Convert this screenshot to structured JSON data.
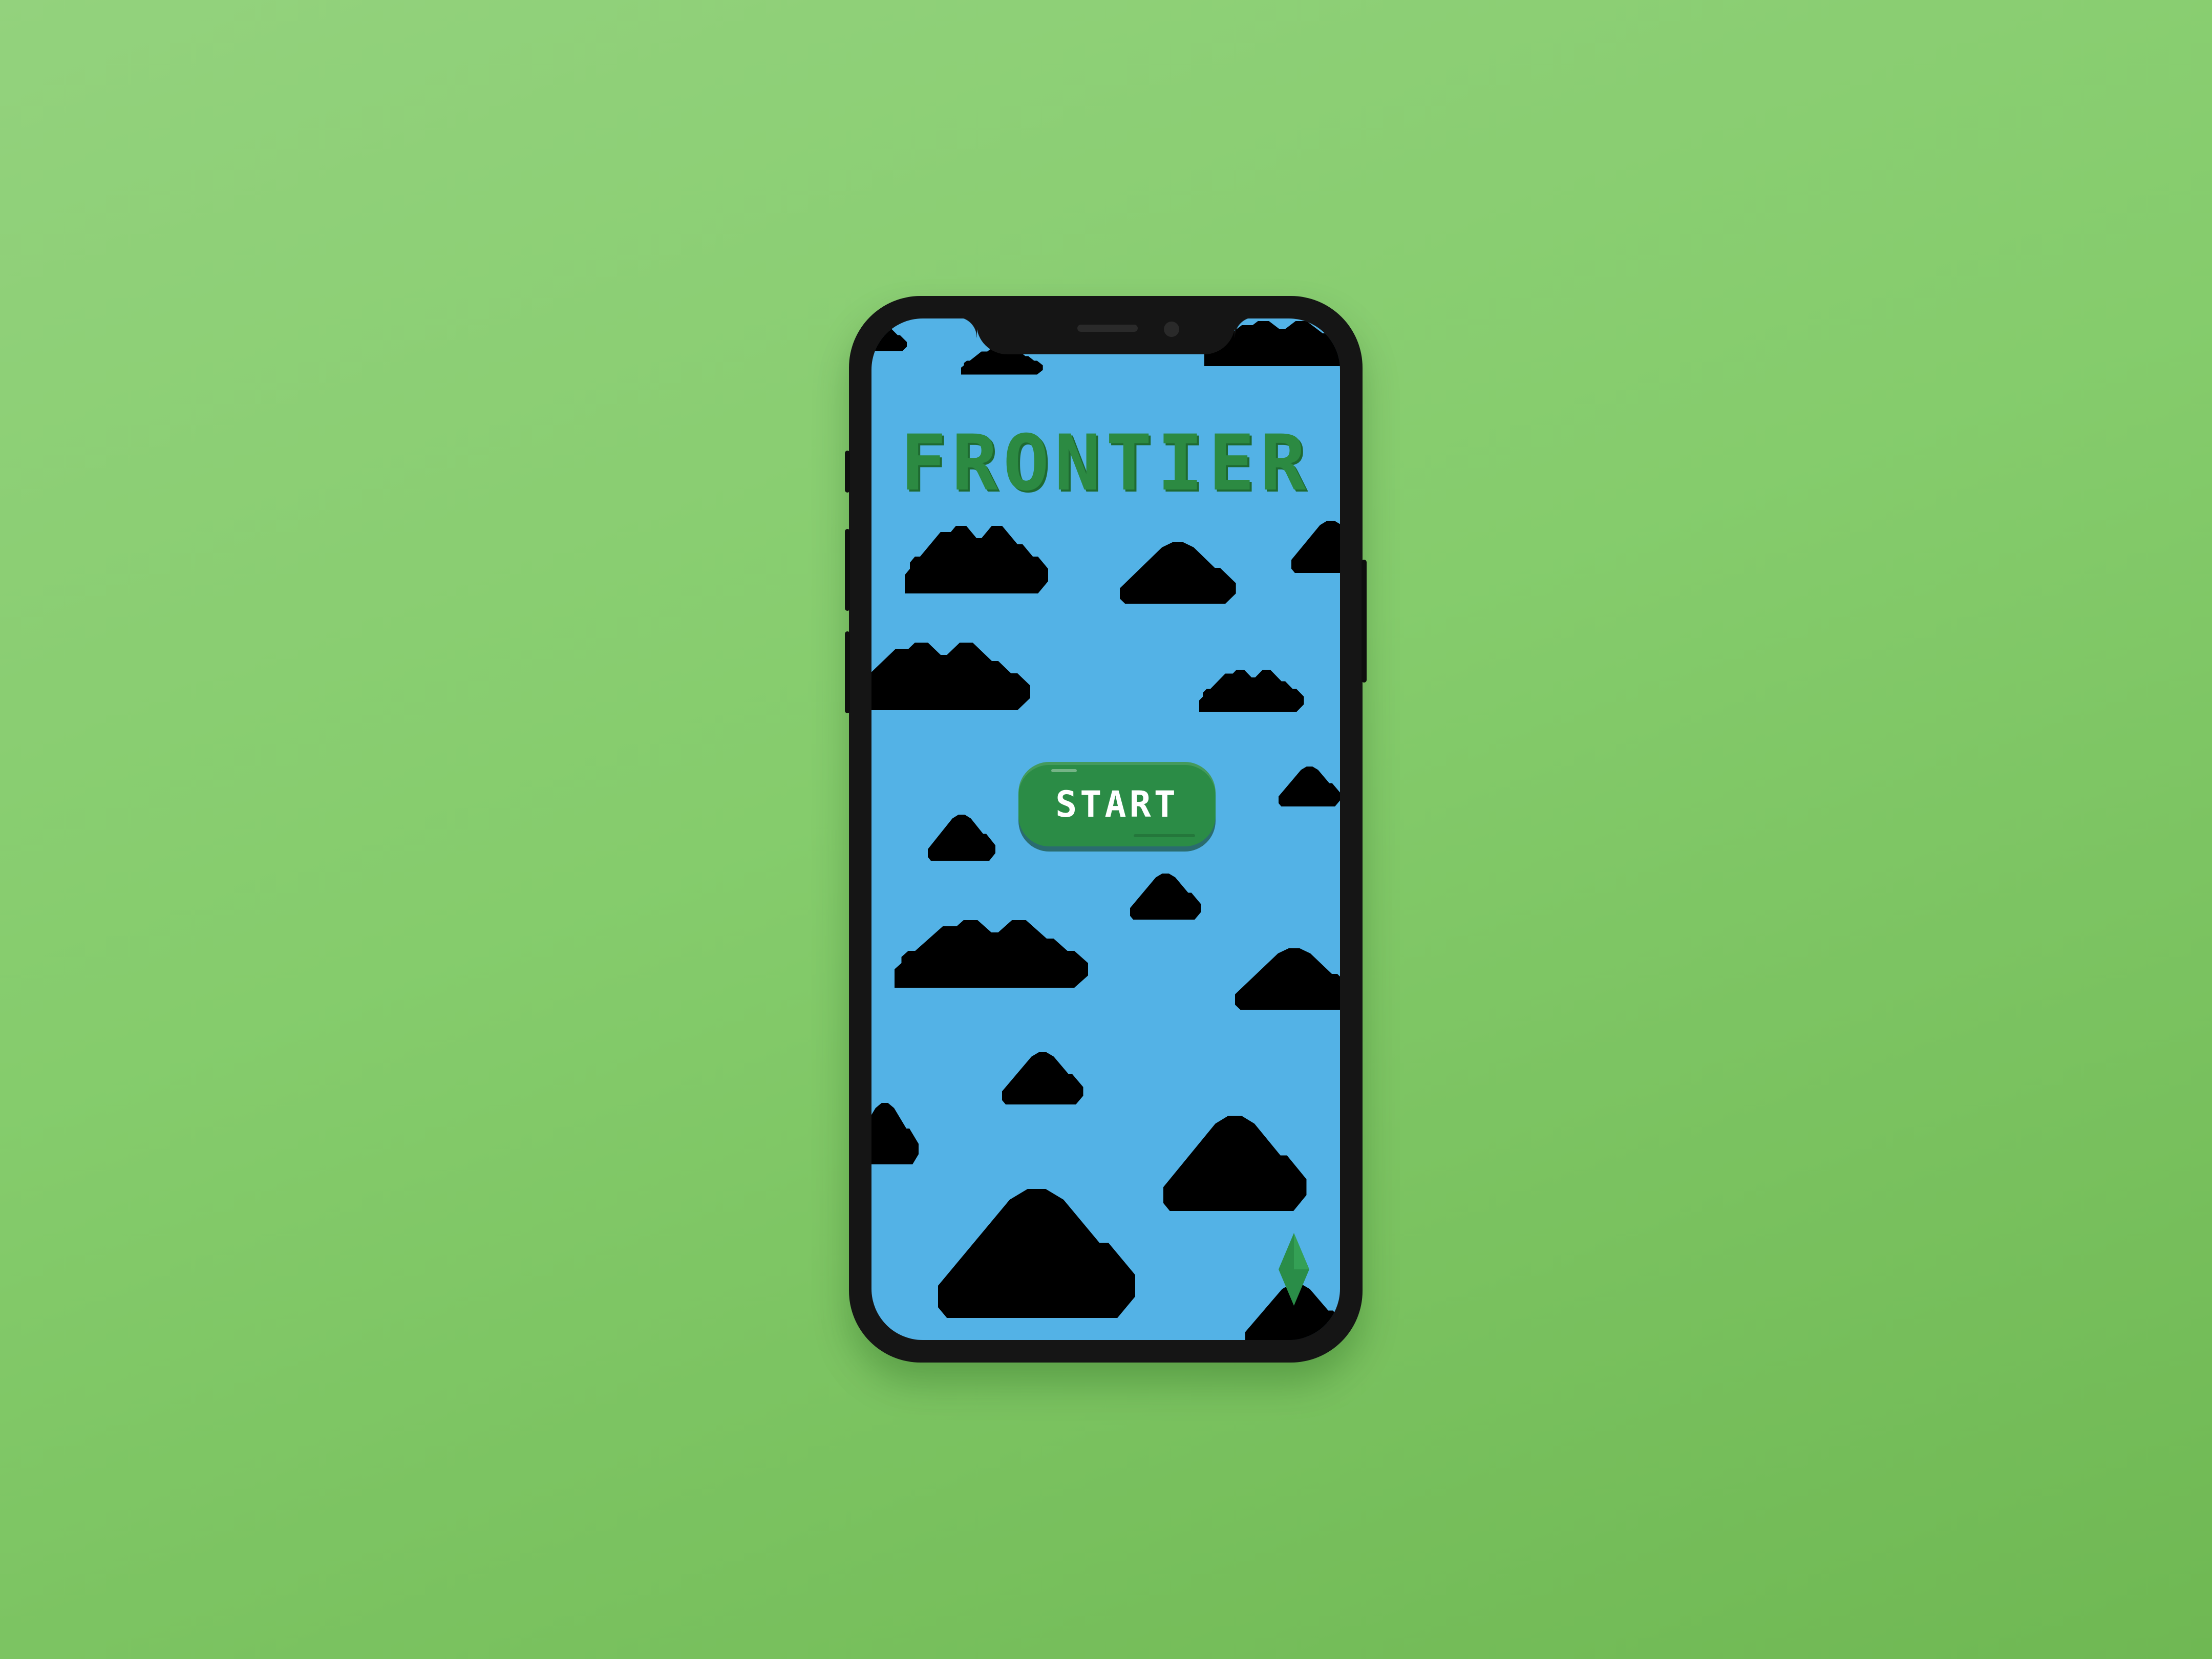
{
  "game": {
    "title": "FRONTIER",
    "start_label": "START"
  },
  "colors": {
    "background": "#85cc6c",
    "sky": "#53b2e6",
    "title": "#2c8a42",
    "button": "#2b8c46",
    "button_text": "#ffffff",
    "gem": "#2a8d48",
    "phone_frame": "#151515"
  },
  "icons": {
    "player_marker": "green-diamond-icon",
    "decor": "pixel-cloud-icon"
  }
}
